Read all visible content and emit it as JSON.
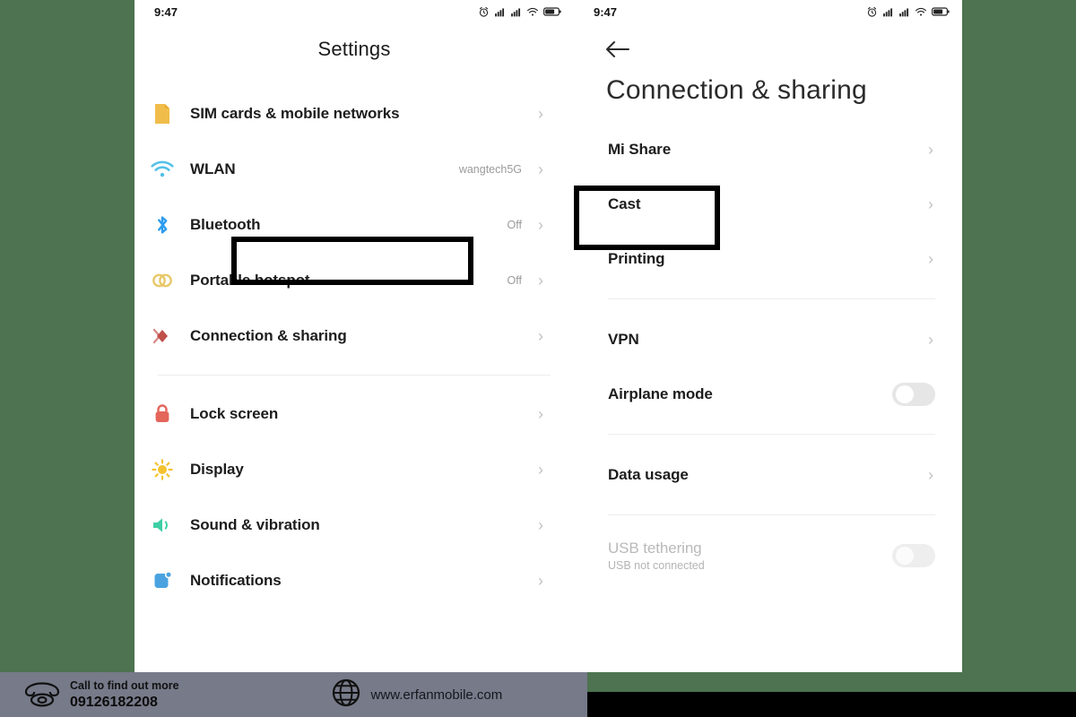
{
  "theme": {
    "page_background": "#4d7350",
    "panel_background": "#ffffff",
    "footer_background": "#767a89",
    "highlight_border": "#000000",
    "chevron": "#c2c2c2",
    "value_text": "#9a9a9a",
    "disabled_text": "#b9b9b9"
  },
  "status_bar": {
    "time": "9:47",
    "icons": [
      "alarm-icon",
      "signal-1-icon",
      "signal-2-icon",
      "wifi-icon",
      "battery-icon"
    ]
  },
  "left_panel": {
    "title": "Settings",
    "groups": [
      {
        "items": [
          {
            "icon": "sim-card-icon",
            "label": "SIM cards & mobile networks",
            "value": "",
            "chevron": "›"
          },
          {
            "icon": "wifi-icon",
            "label": "WLAN",
            "value": "wangtech5G",
            "chevron": "›"
          },
          {
            "icon": "bluetooth-icon",
            "label": "Bluetooth",
            "value": "Off",
            "chevron": "›"
          },
          {
            "icon": "portable-hotspot-icon",
            "label": "Portable hotspot",
            "value": "Off",
            "chevron": "›"
          },
          {
            "icon": "connection-sharing-icon",
            "label": "Connection & sharing",
            "value": "",
            "chevron": "›",
            "highlighted": true
          }
        ]
      },
      {
        "items": [
          {
            "icon": "lock-screen-icon",
            "label": "Lock screen",
            "value": "",
            "chevron": "›"
          },
          {
            "icon": "display-icon",
            "label": "Display",
            "value": "",
            "chevron": "›"
          },
          {
            "icon": "sound-icon",
            "label": "Sound & vibration",
            "value": "",
            "chevron": "›"
          },
          {
            "icon": "notifications-icon",
            "label": "Notifications",
            "value": "",
            "chevron": "›"
          }
        ]
      }
    ]
  },
  "right_panel": {
    "back_icon": "arrow-left-icon",
    "title": "Connection & sharing",
    "groups": [
      {
        "items": [
          {
            "label": "Mi Share",
            "sub": "",
            "control": "chevron",
            "chevron": "›"
          },
          {
            "label": "Cast",
            "sub": "",
            "control": "chevron",
            "chevron": "›",
            "highlighted": true
          },
          {
            "label": "Printing",
            "sub": "",
            "control": "chevron",
            "chevron": "›"
          }
        ]
      },
      {
        "items": [
          {
            "label": "VPN",
            "sub": "",
            "control": "chevron",
            "chevron": "›"
          },
          {
            "label": "Airplane mode",
            "sub": "",
            "control": "toggle",
            "toggle_state": "off"
          }
        ]
      },
      {
        "items": [
          {
            "label": "Data usage",
            "sub": "",
            "control": "chevron",
            "chevron": "›"
          }
        ]
      },
      {
        "items": [
          {
            "label": "USB tethering",
            "sub": "USB not connected",
            "control": "toggle",
            "toggle_state": "off",
            "disabled": true
          }
        ]
      }
    ]
  },
  "footer": {
    "phone_icon": "telephone-icon",
    "call_label": "Call to find out more",
    "phone_number": "09126182208",
    "globe_icon": "globe-icon",
    "website": "www.erfanmobile.com"
  }
}
